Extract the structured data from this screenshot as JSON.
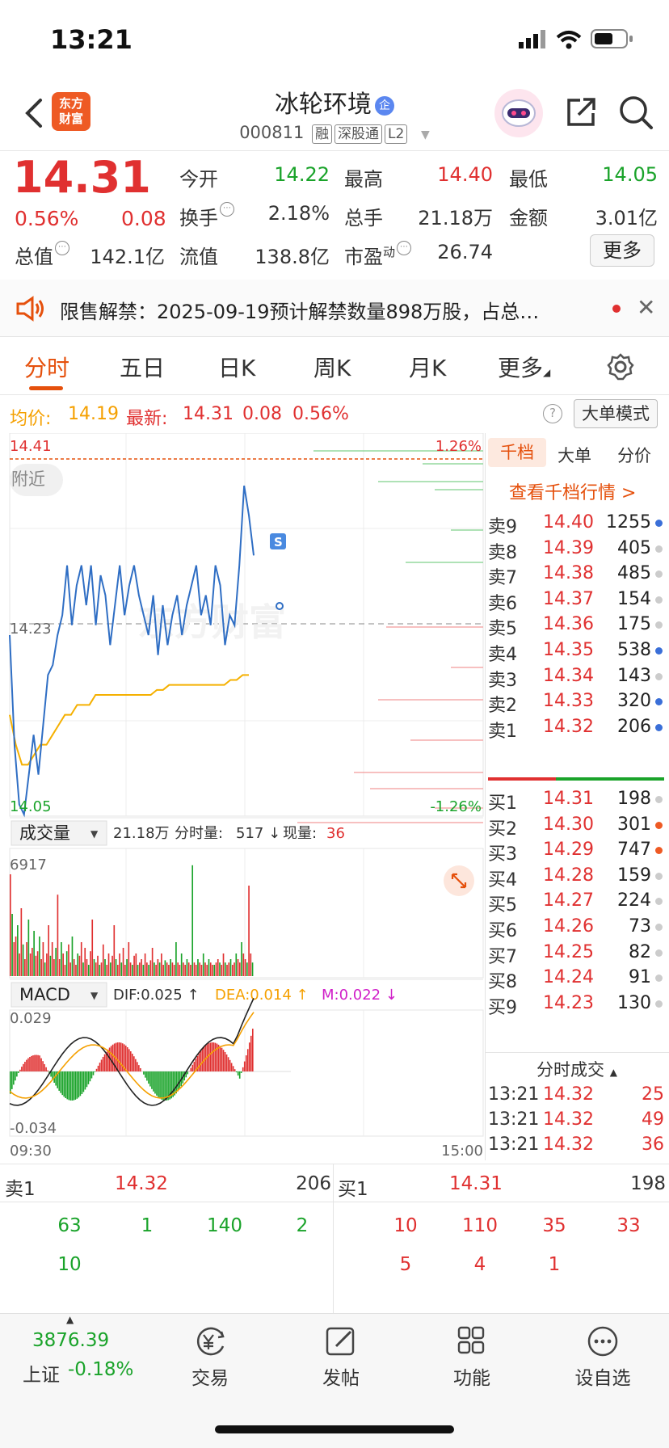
{
  "status": {
    "time": "13:21"
  },
  "header": {
    "stock_name": "冰轮环境",
    "badge": "企",
    "code": "000811",
    "tags": [
      "融",
      "深股通",
      "L2"
    ],
    "logo_text": [
      "东方",
      "财富"
    ]
  },
  "quote": {
    "price": "14.31",
    "change_pct": "0.56%",
    "change": "0.08",
    "labels": {
      "open": "今开",
      "high": "最高",
      "low": "最低",
      "turnover": "换手",
      "volume": "总手",
      "amount": "金额",
      "mktcap": "总值",
      "float": "流值",
      "pe": "市盈",
      "pe_sup": "动"
    },
    "values": {
      "open": "14.22",
      "high": "14.40",
      "low": "14.05",
      "turnover": "2.18%",
      "volume": "21.18万",
      "amount": "3.01亿",
      "mktcap": "142.1亿",
      "float": "138.8亿",
      "pe": "26.74"
    },
    "more_label": "更多"
  },
  "notice": {
    "text": "限售解禁：2025-09-19预计解禁数量898万股，占总…",
    "close": "✕"
  },
  "tabs": [
    "分时",
    "五日",
    "日K",
    "周K",
    "月K",
    "更多"
  ],
  "summary": {
    "avg_label": "均价:",
    "avg": "14.19",
    "latest_label": "最新:",
    "latest": "14.31",
    "chg": "0.08",
    "pct": "0.56%",
    "big_mode": "大单模式"
  },
  "chart_labels": {
    "price_high": "14.41",
    "price_mid": "14.23",
    "price_low": "14.05",
    "pct_high": "1.26%",
    "pct_low": "-1.26%",
    "near_tag": "附近",
    "s_marker": "S",
    "watermark": "东方财富",
    "vol_select": "成交量",
    "vol_total": "21.18万",
    "vol_minute_label": "分时量:",
    "vol_minute": "517 ↓",
    "vol_now_label": "现量:",
    "vol_now": "36",
    "vol_max": "6917",
    "macd_select": "MACD",
    "dif": "DIF:0.025 ↑",
    "dea": "DEA:0.014 ↑",
    "m": "M:0.022 ↓",
    "macd_high": "0.029",
    "macd_low": "-0.034",
    "t_start": "09:30",
    "t_end": "15:00"
  },
  "chart_data": {
    "type": "line",
    "title": "",
    "x_range": [
      "09:30",
      "15:00"
    ],
    "ylim": [
      14.05,
      14.41
    ],
    "prev_close": 14.23,
    "series": [
      {
        "name": "最新",
        "values": [
          14.23,
          14.12,
          14.06,
          14.05,
          14.09,
          14.13,
          14.09,
          14.14,
          14.19,
          14.2,
          14.23,
          14.25,
          14.3,
          14.24,
          14.28,
          14.3,
          14.26,
          14.3,
          14.24,
          14.29,
          14.27,
          14.22,
          14.26,
          14.3,
          14.25,
          14.28,
          14.3,
          14.27,
          14.25,
          14.23,
          14.27,
          14.21,
          14.26,
          14.22,
          14.25,
          14.27,
          14.23,
          14.26,
          14.28,
          14.3,
          14.25,
          14.27,
          14.24,
          14.3,
          14.28,
          14.22,
          14.25,
          14.24,
          14.3,
          14.38,
          14.35,
          14.31
        ]
      },
      {
        "name": "均价",
        "values": [
          14.15,
          14.12,
          14.1,
          14.1,
          14.11,
          14.12,
          14.12,
          14.13,
          14.14,
          14.15,
          14.15,
          14.16,
          14.16,
          14.16,
          14.17,
          14.17,
          14.17,
          14.17,
          14.17,
          14.17,
          14.17,
          14.17,
          14.17,
          14.17,
          14.175,
          14.175,
          14.18,
          14.18,
          14.18,
          14.18,
          14.18,
          14.18,
          14.18,
          14.18,
          14.18,
          14.18,
          14.185,
          14.185,
          14.19,
          14.19
        ]
      }
    ]
  },
  "orderbook": {
    "tabs": [
      "千档",
      "大单",
      "分价"
    ],
    "promo": "查看千档行情 >",
    "asks": [
      {
        "label": "卖9",
        "price": "14.40",
        "vol": "1255",
        "dot": "#3a6fd8"
      },
      {
        "label": "卖8",
        "price": "14.39",
        "vol": "405",
        "dot": "#cccccc"
      },
      {
        "label": "卖7",
        "price": "14.38",
        "vol": "485",
        "dot": "#cccccc"
      },
      {
        "label": "卖6",
        "price": "14.37",
        "vol": "154",
        "dot": "#cccccc"
      },
      {
        "label": "卖5",
        "price": "14.36",
        "vol": "175",
        "dot": "#cccccc"
      },
      {
        "label": "卖4",
        "price": "14.35",
        "vol": "538",
        "dot": "#3a6fd8"
      },
      {
        "label": "卖3",
        "price": "14.34",
        "vol": "143",
        "dot": "#cccccc"
      },
      {
        "label": "卖2",
        "price": "14.33",
        "vol": "320",
        "dot": "#3a6fd8"
      },
      {
        "label": "卖1",
        "price": "14.32",
        "vol": "206",
        "dot": "#3a6fd8"
      }
    ],
    "bids": [
      {
        "label": "买1",
        "price": "14.31",
        "vol": "198",
        "dot": "#cccccc"
      },
      {
        "label": "买2",
        "price": "14.30",
        "vol": "301",
        "dot": "#ee5a24"
      },
      {
        "label": "买3",
        "price": "14.29",
        "vol": "747",
        "dot": "#ee5a24"
      },
      {
        "label": "买4",
        "price": "14.28",
        "vol": "159",
        "dot": "#cccccc"
      },
      {
        "label": "买5",
        "price": "14.27",
        "vol": "224",
        "dot": "#cccccc"
      },
      {
        "label": "买6",
        "price": "14.26",
        "vol": "73",
        "dot": "#cccccc"
      },
      {
        "label": "买7",
        "price": "14.25",
        "vol": "82",
        "dot": "#cccccc"
      },
      {
        "label": "买8",
        "price": "14.24",
        "vol": "91",
        "dot": "#cccccc"
      },
      {
        "label": "买9",
        "price": "14.23",
        "vol": "130",
        "dot": "#cccccc"
      }
    ],
    "trades_title": "分时成交",
    "trades": [
      {
        "time": "13:21",
        "price": "14.32",
        "vol": "25"
      },
      {
        "time": "13:21",
        "price": "14.32",
        "vol": "49"
      },
      {
        "time": "13:21",
        "price": "14.32",
        "vol": "36"
      }
    ]
  },
  "bottom_book": {
    "sell_label": "卖1",
    "sell_price": "14.32",
    "sell_vol": "206",
    "buy_label": "买1",
    "buy_price": "14.31",
    "buy_vol": "198",
    "sell_queue": [
      [
        "63",
        "1",
        "140",
        "2"
      ],
      [
        "10"
      ]
    ],
    "buy_queue": [
      [
        "10",
        "110",
        "35",
        "33"
      ],
      [
        "5",
        "4",
        "1"
      ]
    ]
  },
  "bottom_nav": {
    "index_value": "3876.39",
    "index_name": "上证",
    "index_pct": "-0.18%",
    "items": [
      "交易",
      "发帖",
      "功能",
      "设自选"
    ]
  },
  "colors": {
    "up": "#e03030",
    "down": "#1aa32a",
    "accent": "#e5500c",
    "price_line": "#2f6ec4",
    "avg_line": "#f5b000"
  }
}
